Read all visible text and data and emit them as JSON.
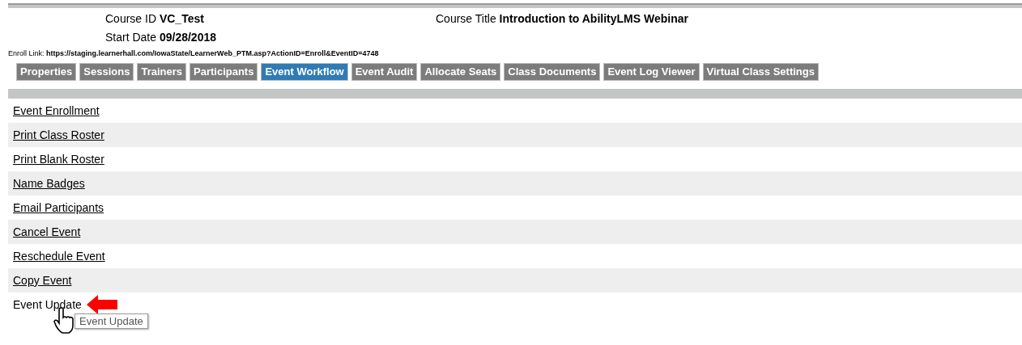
{
  "header": {
    "course_id_label": "Course ID",
    "course_id": "VC_Test",
    "course_title_label": "Course Title",
    "course_title": "Introduction to AbilityLMS Webinar",
    "start_date_label": "Start Date",
    "start_date": "09/28/2018",
    "enroll_link_label": "Enroll Link:",
    "enroll_link": "https://staging.learnerhall.com/IowaState/LearnerWeb_PTM.asp?ActionID=Enroll&EventID=4748"
  },
  "tabs": [
    {
      "label": "Properties",
      "selected": false
    },
    {
      "label": "Sessions",
      "selected": false
    },
    {
      "label": "Trainers",
      "selected": false
    },
    {
      "label": "Participants",
      "selected": false
    },
    {
      "label": "Event Workflow",
      "selected": true
    },
    {
      "label": "Event Audit",
      "selected": false
    },
    {
      "label": "Allocate Seats",
      "selected": false
    },
    {
      "label": "Class Documents",
      "selected": false
    },
    {
      "label": "Event Log Viewer",
      "selected": false
    },
    {
      "label": "Virtual Class Settings",
      "selected": false
    }
  ],
  "workflow_items": [
    {
      "label": "Event Enrollment",
      "hovered": false
    },
    {
      "label": "Print Class Roster",
      "hovered": false
    },
    {
      "label": "Print Blank Roster",
      "hovered": false
    },
    {
      "label": "Name Badges",
      "hovered": false
    },
    {
      "label": "Email Participants",
      "hovered": false
    },
    {
      "label": "Cancel Event",
      "hovered": false
    },
    {
      "label": "Reschedule Event",
      "hovered": false
    },
    {
      "label": "Copy Event",
      "hovered": false
    },
    {
      "label": "Event Update",
      "hovered": true
    }
  ],
  "tooltip": "Event Update"
}
